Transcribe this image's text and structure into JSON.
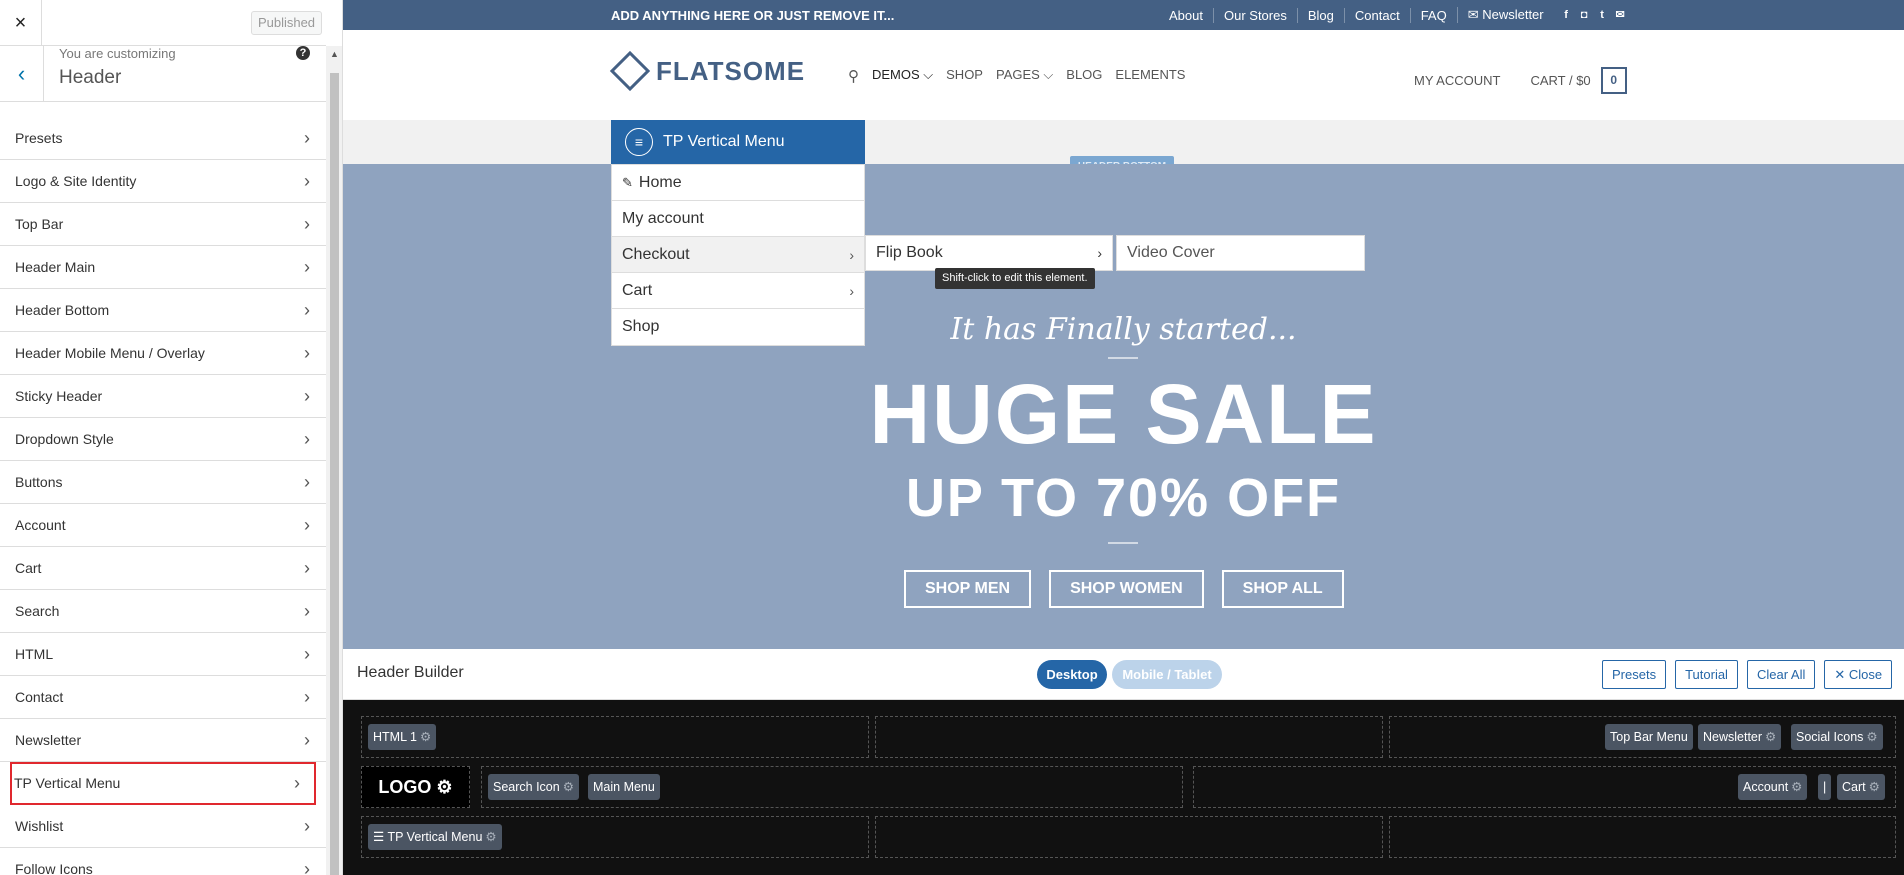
{
  "sidebar": {
    "close": "×",
    "published": "Published",
    "back": "‹",
    "customizing": "You are customizing",
    "section": "Header",
    "help": "?",
    "scroll_up": "▲",
    "items": [
      {
        "label": "Presets"
      },
      {
        "label": "Logo & Site Identity"
      },
      {
        "label": "Top Bar"
      },
      {
        "label": "Header Main"
      },
      {
        "label": "Header Bottom"
      },
      {
        "label": "Header Mobile Menu / Overlay"
      },
      {
        "label": "Sticky Header"
      },
      {
        "label": "Dropdown Style"
      },
      {
        "label": "Buttons"
      },
      {
        "label": "Account"
      },
      {
        "label": "Cart"
      },
      {
        "label": "Search"
      },
      {
        "label": "HTML"
      },
      {
        "label": "Contact"
      },
      {
        "label": "Newsletter"
      },
      {
        "label": "TP Vertical Menu"
      },
      {
        "label": "Wishlist"
      },
      {
        "label": "Follow Icons"
      }
    ],
    "highlight_color": "#e0282e"
  },
  "topbar": {
    "message": "ADD ANYTHING HERE OR JUST REMOVE IT...",
    "links": [
      "About",
      "Our Stores",
      "Blog",
      "Contact",
      "FAQ",
      "✉ Newsletter"
    ],
    "social_icons": [
      "facebook-icon",
      "instagram-icon",
      "twitter-icon",
      "email-icon"
    ],
    "bg": "#446084"
  },
  "header": {
    "logo_text": "FLATSOME",
    "nav": [
      "DEMOS ⌵",
      "SHOP",
      "PAGES ⌵",
      "BLOG",
      "ELEMENTS"
    ],
    "account": "MY ACCOUNT",
    "cart": "CART / $0",
    "cart_count": "0"
  },
  "header_bottom_label": "HEADER BOTTOM",
  "vertical_menu": {
    "title": "TP Vertical Menu",
    "items": [
      "Home",
      "My account",
      "Checkout",
      "Cart",
      "Shop"
    ],
    "sub1": "Flip Book",
    "sub2": "Video Cover",
    "tooltip": "Shift-click to edit this element.",
    "color": "#2566a7"
  },
  "hero": {
    "script": "It has Finally started...",
    "title": "HUGE SALE",
    "subtitle": "UP TO 70% OFF",
    "buttons": [
      "SHOP MEN",
      "SHOP WOMEN",
      "SHOP ALL"
    ]
  },
  "builder": {
    "title": "Header Builder",
    "desktop": "Desktop",
    "mobile": "Mobile / Tablet",
    "actions": [
      "Presets",
      "Tutorial",
      "Clear All",
      "✕ Close"
    ],
    "logo": "LOGO ⚙",
    "chips": {
      "html1": "HTML 1",
      "topbar_menu": "Top Bar Menu",
      "newsletter": "Newsletter",
      "social": "Social Icons",
      "search": "Search Icon",
      "main_menu": "Main Menu",
      "account": "Account",
      "divider": "|",
      "cart": "Cart",
      "vmenu": "☰ TP Vertical Menu"
    },
    "gear": "⚙"
  }
}
